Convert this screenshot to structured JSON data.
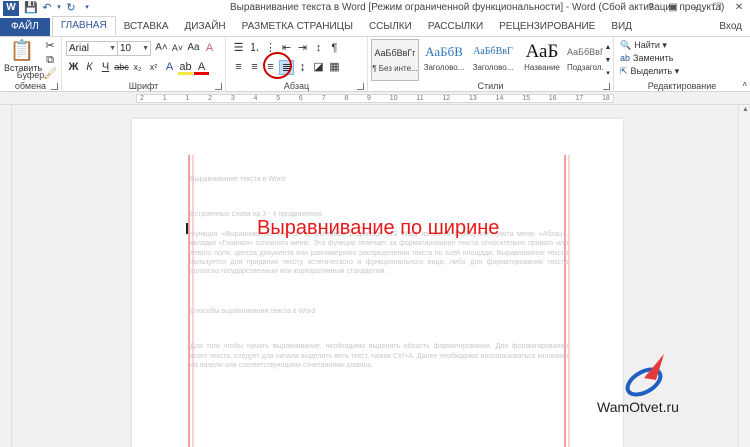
{
  "titlebar": {
    "doc_title": "Выравнивание текста в Word [Режим ограниченной функциональности] - Word (Сбой активации продукта)",
    "controls": [
      "?",
      "▣",
      "–",
      "☐",
      "✕"
    ]
  },
  "tabs": [
    "ФАЙЛ",
    "ГЛАВНАЯ",
    "ВСТАВКА",
    "ДИЗАЙН",
    "РАЗМЕТКА СТРАНИЦЫ",
    "ССЫЛКИ",
    "РАССЫЛКИ",
    "РЕЦЕНЗИРОВАНИЕ",
    "ВИД"
  ],
  "signin": "Вход",
  "ribbon": {
    "clipboard": {
      "paste": "Вставить",
      "label": "Буфер обмена"
    },
    "font": {
      "name": "Arial",
      "size": "10",
      "label": "Шрифт"
    },
    "paragraph": {
      "label": "Абзац"
    },
    "styles": {
      "label": "Стили",
      "items": [
        {
          "preview": "АаБбВвГг",
          "name": "¶ Без инте..."
        },
        {
          "preview": "АаБбВ",
          "name": "Заголово..."
        },
        {
          "preview": "АаБбВвГ",
          "name": "Заголово..."
        },
        {
          "preview": "АаБ",
          "name": "Название"
        },
        {
          "preview": "АаБбВвГ",
          "name": "Подзагол..."
        }
      ]
    },
    "editing": {
      "find": "Найти",
      "replace": "Заменить",
      "select": "Выделить",
      "label": "Редактирование"
    }
  },
  "ruler": {
    "numbers": [
      "2",
      "1",
      "1",
      "2",
      "3",
      "4",
      "5",
      "6",
      "7",
      "8",
      "9",
      "10",
      "11",
      "12",
      "13",
      "14",
      "15",
      "16",
      "17",
      "18"
    ]
  },
  "document": {
    "heading": "Выравнивание текста в Word",
    "subheading": "Встроенные слова на 3 - 4 продвижения.",
    "paragraph": "Функция «Выравнивание текста» в текстовом редакторе MS Word является атрибутом пункта меню «Абзац», вкладки «Главная» основного меню. Эта функция отвечает за форматирование текста относительно правого или левого поля, центра документа или равномерного распределения текста по всей площади. Выравнивание текста пользуется для придания тексту эстетического и функционального вида, либо для форматирования текста согласно государственным или корпоративным стандартам.",
    "heading2": "Способы выравнивания текста в Word",
    "paragraph2": "Для того чтобы начать выравнивание, необходимо выделить область форматирования. Для форматирования всего текста, следует для начала выделить весь текст, нажав Ctrl+A. Далее необходимо воспользоваться кнопками на панели или соответствующими сочетаниями клавиш."
  },
  "caption": "Выравнивание по ширине",
  "watermark": {
    "text": "WamOtvet.ru"
  },
  "colors": {
    "accent": "#2b579a",
    "caption": "#e81919",
    "highlight": "#cc0000"
  }
}
